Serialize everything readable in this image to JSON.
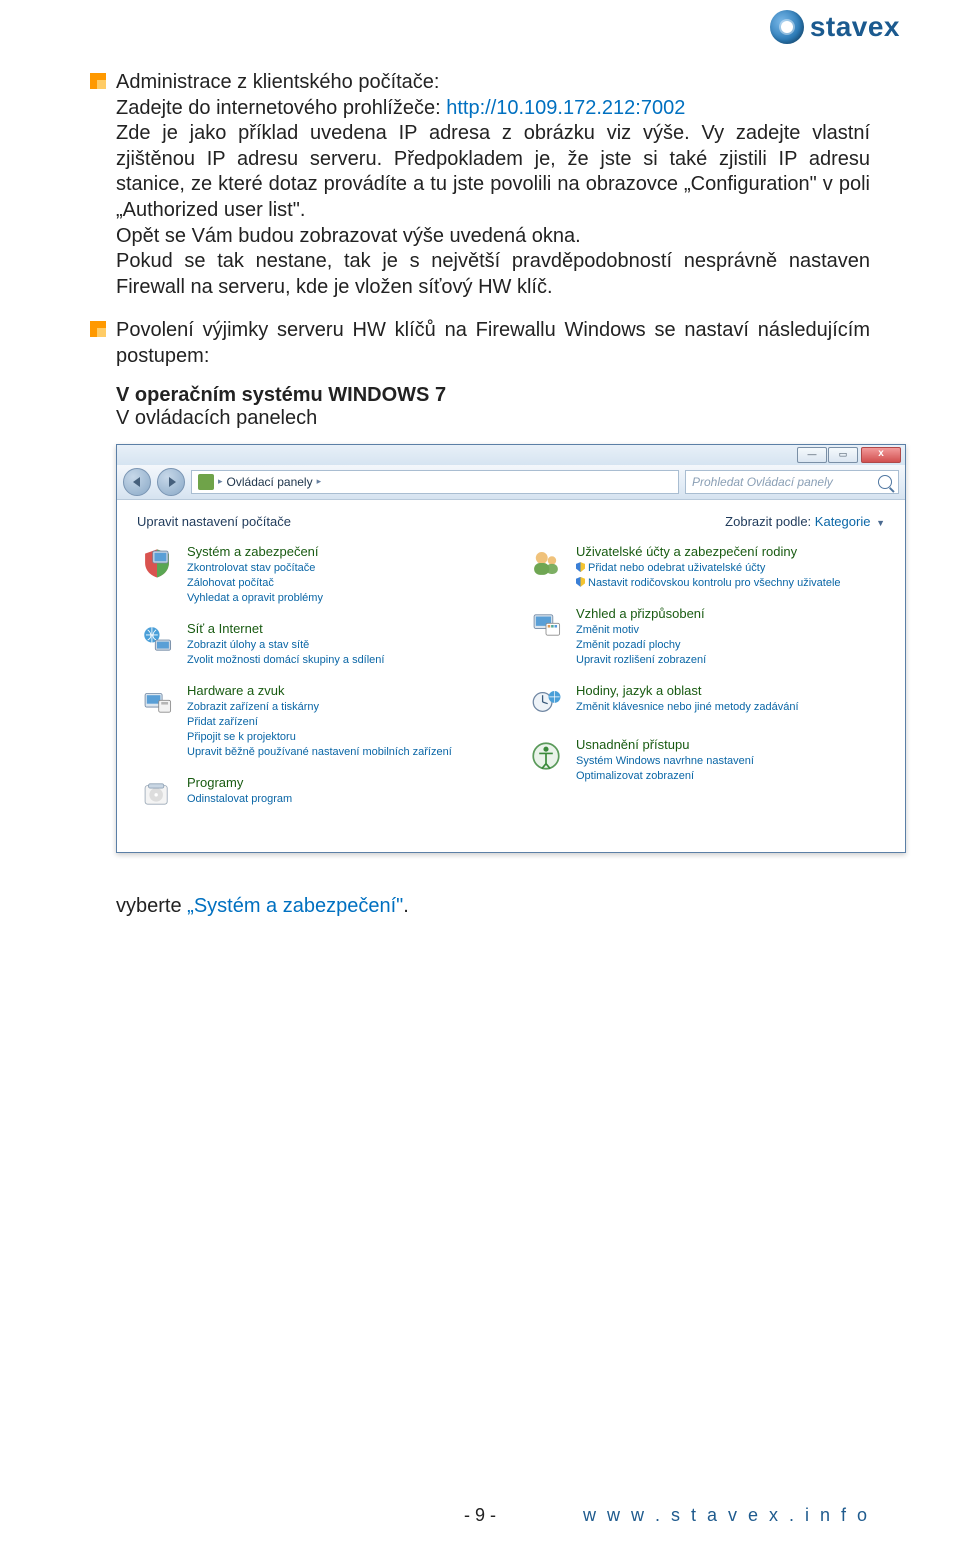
{
  "logo": {
    "text": "stavex"
  },
  "para1": {
    "heading": "Administrace z klientského počítače:",
    "line2a": "Zadejte do internetového prohlížeče: ",
    "link": "http://10.109.172.212:7002",
    "line3": "Zde je jako příklad uvedena IP adresa z obrázku viz výše. Vy zadejte vlastní zjištěnou IP adresu serveru. Předpokladem je, že jste si také zjistili IP adresu stanice, ze které dotaz provádíte a tu jste povolili na obrazovce „Configuration\" v poli „Authorized user list\".",
    "line4": "Opět se Vám budou zobrazovat výše uvedená okna.",
    "line5": "Pokud se tak nestane, tak je s největší pravděpodobností nesprávně nastaven Firewall na serveru, kde je vložen síťový HW klíč."
  },
  "para2": {
    "text": "Povolení výjimky serveru HW klíčů na Firewallu Windows se nastaví následujícím postupem:",
    "os_line": "V operačním systému WINDOWS 7",
    "panels_line": "V ovládacích panelech"
  },
  "cp": {
    "titlebar": {
      "min": "—",
      "max": "▭",
      "close": "x"
    },
    "nav": {
      "crumb": "Ovládací panely",
      "chev1": "▸",
      "chev2": "▸",
      "search_placeholder": "Prohledat Ovládací panely"
    },
    "bar": {
      "adjust": "Upravit nastavení počítače",
      "view_label": "Zobrazit podle:",
      "view_value": "Kategorie"
    },
    "left": [
      {
        "main": "Systém a zabezpečení",
        "subs": [
          {
            "t": "Zkontrolovat stav počítače",
            "s": false
          },
          {
            "t": "Zálohovat počítač",
            "s": false
          },
          {
            "t": "Vyhledat a opravit problémy",
            "s": false
          }
        ],
        "icon": "shield"
      },
      {
        "main": "Síť a Internet",
        "subs": [
          {
            "t": "Zobrazit úlohy a stav sítě",
            "s": false
          },
          {
            "t": "Zvolit možnosti domácí skupiny a sdílení",
            "s": false
          }
        ],
        "icon": "network"
      },
      {
        "main": "Hardware a zvuk",
        "subs": [
          {
            "t": "Zobrazit zařízení a tiskárny",
            "s": false
          },
          {
            "t": "Přidat zařízení",
            "s": false
          },
          {
            "t": "Připojit se k projektoru",
            "s": false
          },
          {
            "t": "Upravit běžně používané nastavení mobilních zařízení",
            "s": false
          }
        ],
        "icon": "hardware"
      },
      {
        "main": "Programy",
        "subs": [
          {
            "t": "Odinstalovat program",
            "s": false
          }
        ],
        "icon": "programs"
      }
    ],
    "right": [
      {
        "main": "Uživatelské účty a zabezpečení rodiny",
        "subs": [
          {
            "t": "Přidat nebo odebrat uživatelské účty",
            "s": true
          },
          {
            "t": "Nastavit rodičovskou kontrolu pro všechny uživatele",
            "s": true
          }
        ],
        "icon": "users"
      },
      {
        "main": "Vzhled a přizpůsobení",
        "subs": [
          {
            "t": "Změnit motiv",
            "s": false
          },
          {
            "t": "Změnit pozadí plochy",
            "s": false
          },
          {
            "t": "Upravit rozlišení zobrazení",
            "s": false
          }
        ],
        "icon": "appearance"
      },
      {
        "main": "Hodiny, jazyk a oblast",
        "subs": [
          {
            "t": "Změnit klávesnice nebo jiné metody zadávání",
            "s": false
          }
        ],
        "icon": "clock"
      },
      {
        "main": "Usnadnění přístupu",
        "subs": [
          {
            "t": "Systém Windows navrhne nastavení",
            "s": false
          },
          {
            "t": "Optimalizovat zobrazení",
            "s": false
          }
        ],
        "icon": "ease"
      }
    ]
  },
  "select_line": {
    "pre": "vyberte ",
    "sel": "„Systém a zabezpečení\"",
    "post": "."
  },
  "footer": {
    "page": "- 9 -",
    "url": "w w w . s t a v e x . i n f o"
  }
}
